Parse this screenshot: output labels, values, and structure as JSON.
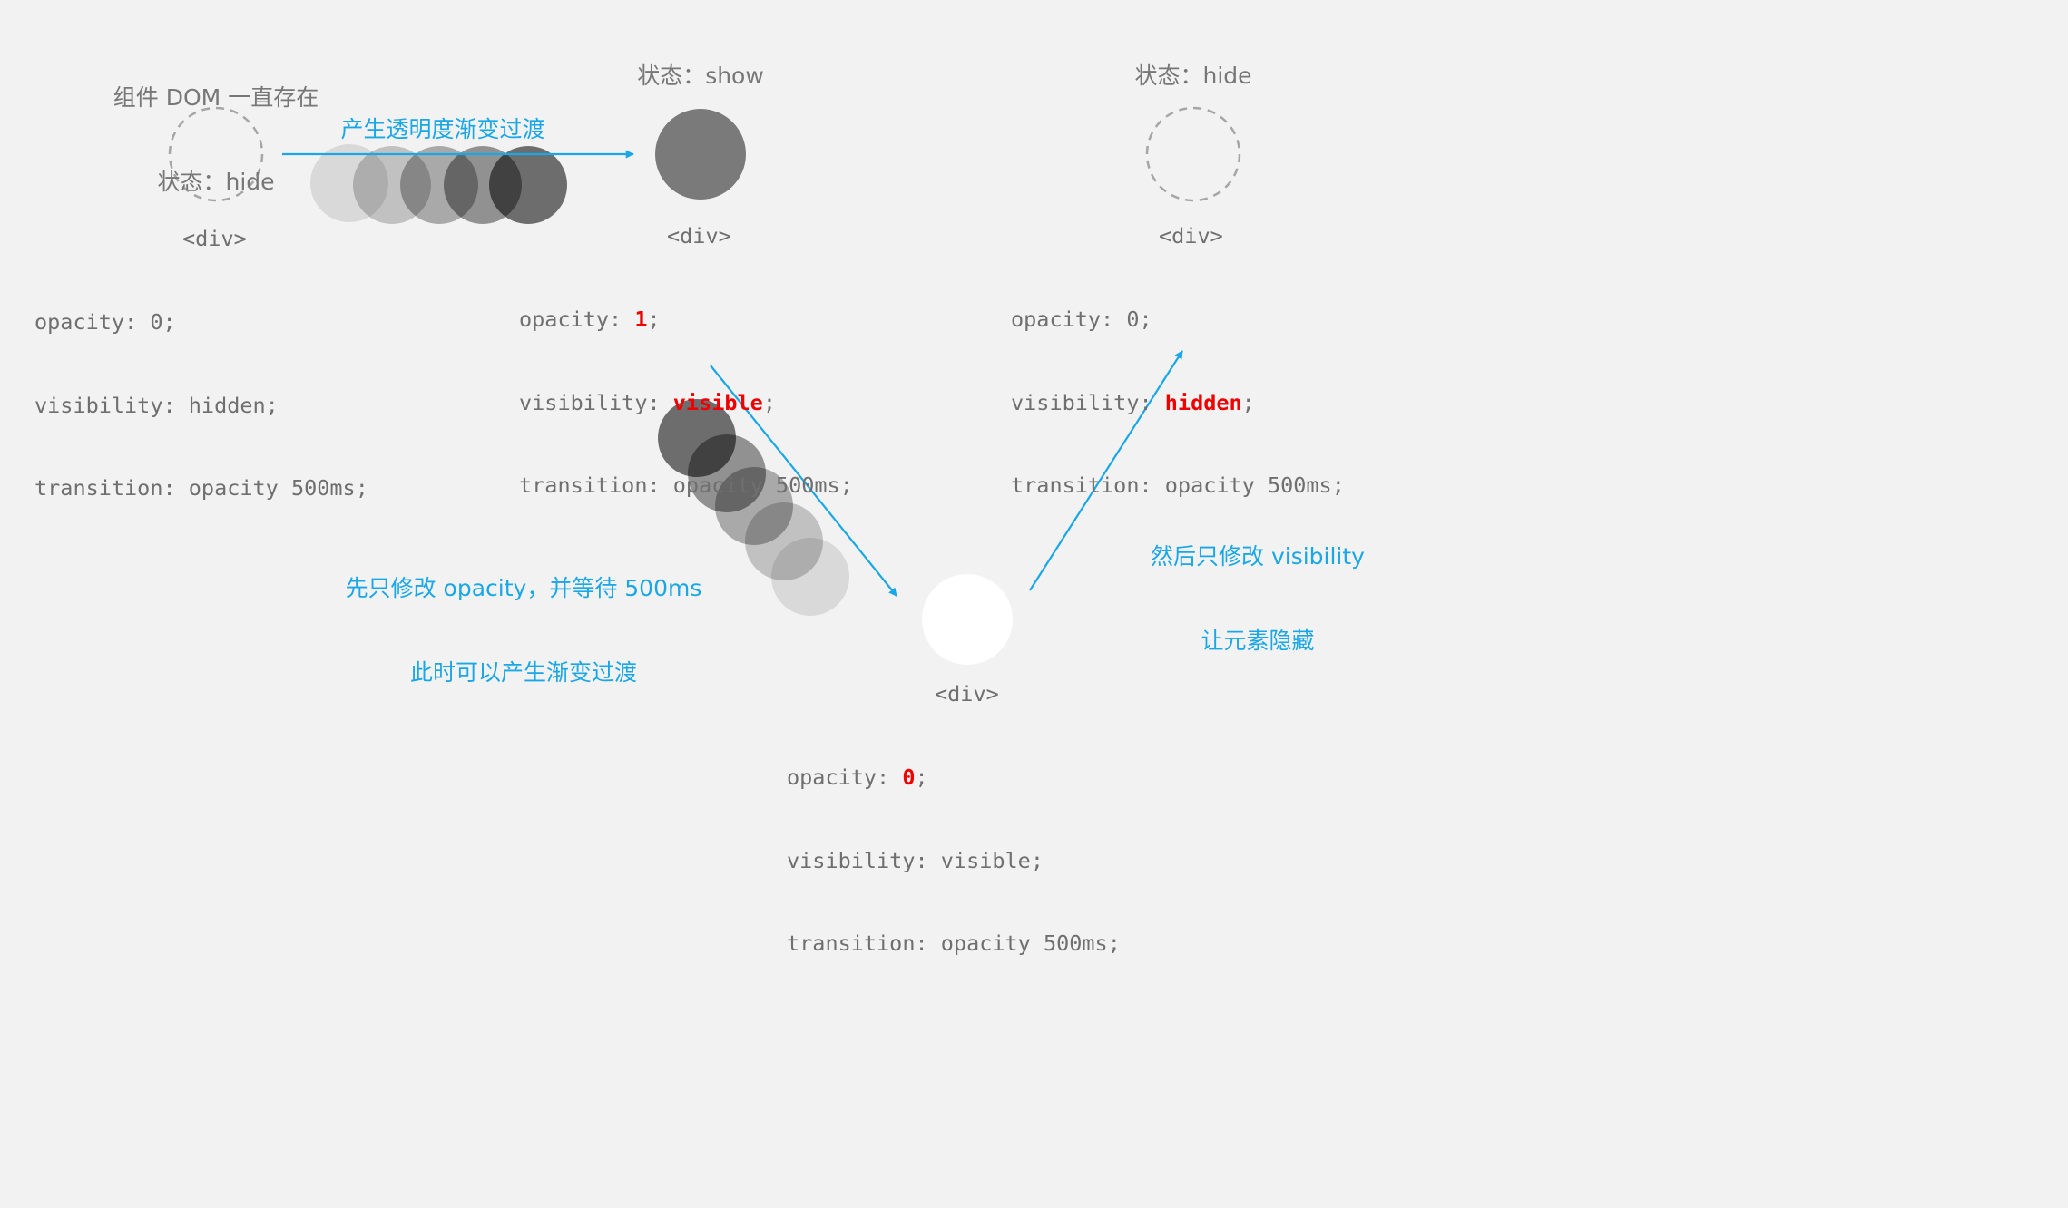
{
  "states": [
    {
      "title_line1": "组件 DOM 一直存在",
      "title_line2": "状态：hide",
      "tag": "<div>",
      "opacity_key": "opacity: ",
      "opacity_value": "0",
      "visibility_key": "visibility: ",
      "visibility_value": "hidden",
      "transition": "transition: opacity 500ms;"
    },
    {
      "title_line1": "状态：show",
      "tag": "<div>",
      "opacity_key": "opacity: ",
      "opacity_value": "1",
      "visibility_key": "visibility: ",
      "visibility_value": "visible",
      "transition": "transition: opacity 500ms;"
    },
    {
      "title_line1": "状态：hide",
      "tag": "<div>",
      "opacity_key": "opacity: ",
      "opacity_value": "0",
      "visibility_key": "visibility: ",
      "visibility_value": "hidden",
      "transition": "transition: opacity 500ms;"
    },
    {
      "tag": "<div>",
      "opacity_key": "opacity: ",
      "opacity_value": "0",
      "visibility_key": "visibility: ",
      "visibility_value": "visible",
      "transition": "transition: opacity 500ms;"
    }
  ],
  "semicolon": ";",
  "labels": {
    "fade_in": "产生透明度渐变过渡",
    "fade_out_line1": "先只修改 opacity，并等待 500ms",
    "fade_out_line2": "此时可以产生渐变过渡",
    "hide_line1": "然后只修改 visibility",
    "hide_line2": "让元素隐藏"
  },
  "colors": {
    "background": "#f2f2f2",
    "text": "#6f6f6f",
    "accent": "#1aa7e6",
    "highlight": "#ee0000",
    "circle_shown": "#7a7a7a",
    "circle_white": "#ffffff",
    "dashed_outline": "#a6a6a6"
  },
  "fade_in_sequence_opacity": [
    0.1,
    0.2,
    0.3,
    0.4,
    0.55
  ],
  "fade_out_sequence_opacity": [
    0.55,
    0.4,
    0.3,
    0.2,
    0.1
  ]
}
